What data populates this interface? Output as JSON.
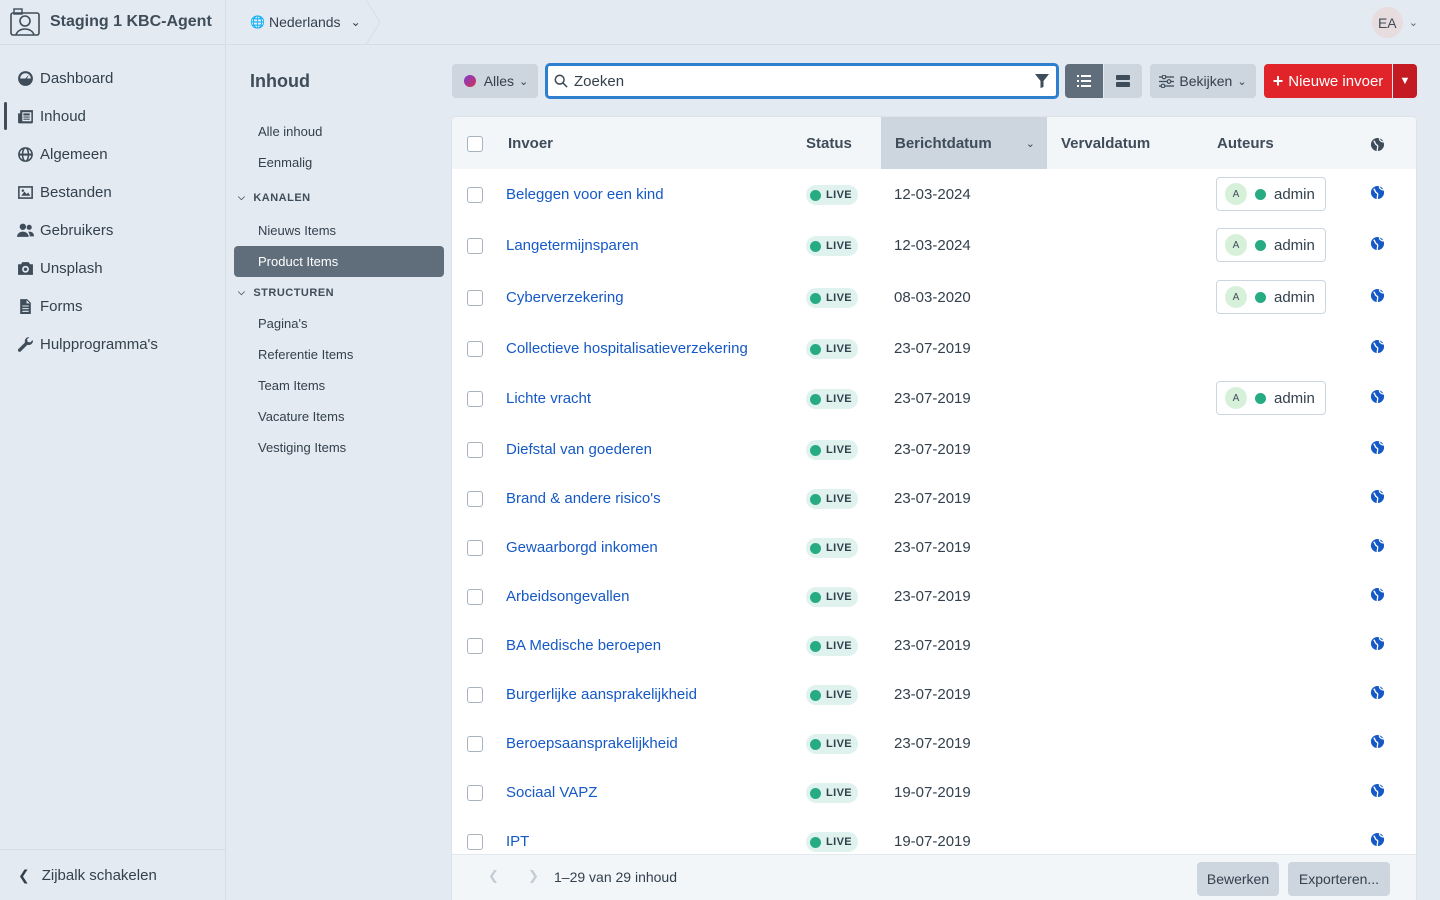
{
  "site": {
    "name": "Staging 1 KBC-Agent"
  },
  "global_nav": [
    {
      "label": "Dashboard",
      "icon": "gauge-icon"
    },
    {
      "label": "Inhoud",
      "icon": "newspaper-icon",
      "active": true
    },
    {
      "label": "Algemeen",
      "icon": "globe-icon"
    },
    {
      "label": "Bestanden",
      "icon": "image-icon"
    },
    {
      "label": "Gebruikers",
      "icon": "users-icon"
    },
    {
      "label": "Unsplash",
      "icon": "camera-icon"
    },
    {
      "label": "Forms",
      "icon": "file-icon"
    },
    {
      "label": "Hulpprogramma's",
      "icon": "wrench-icon"
    }
  ],
  "sidebar_toggle": {
    "label": "Zijbalk schakelen"
  },
  "header": {
    "language": "Nederlands",
    "user_initials": "EA"
  },
  "sources": {
    "title": "Inhoud",
    "items": [
      {
        "type": "item",
        "label": "Alle inhoud"
      },
      {
        "type": "item",
        "label": "Eenmalig"
      },
      {
        "type": "heading",
        "label": "KANALEN"
      },
      {
        "type": "item",
        "label": "Nieuws Items"
      },
      {
        "type": "item",
        "label": "Product Items",
        "active": true
      },
      {
        "type": "heading",
        "label": "STRUCTUREN"
      },
      {
        "type": "item",
        "label": "Pagina's"
      },
      {
        "type": "item",
        "label": "Referentie Items"
      },
      {
        "type": "item",
        "label": "Team Items"
      },
      {
        "type": "item",
        "label": "Vacature Items"
      },
      {
        "type": "item",
        "label": "Vestiging Items"
      }
    ]
  },
  "toolbar": {
    "site_label": "Alles",
    "search_placeholder": "Zoeken",
    "view_label": "Bekijken",
    "new_entry_label": "Nieuwe invoer"
  },
  "table": {
    "columns": {
      "entry": "Invoer",
      "status": "Status",
      "post_date": "Berichtdatum",
      "expiry_date": "Vervaldatum",
      "authors": "Auteurs"
    },
    "rows": [
      {
        "title": "Beleggen voor een kind",
        "status": "LIVE",
        "post_date": "12-03-2024",
        "author_initial": "A",
        "author": "admin"
      },
      {
        "title": "Langetermijnsparen",
        "status": "LIVE",
        "post_date": "12-03-2024",
        "author_initial": "A",
        "author": "admin"
      },
      {
        "title": "Cyberverzekering",
        "status": "LIVE",
        "post_date": "08-03-2020",
        "author_initial": "A",
        "author": "admin"
      },
      {
        "title": "Collectieve hospitalisatieverzekering",
        "status": "LIVE",
        "post_date": "23-07-2019",
        "author": ""
      },
      {
        "title": "Lichte vracht",
        "status": "LIVE",
        "post_date": "23-07-2019",
        "author_initial": "A",
        "author": "admin"
      },
      {
        "title": "Diefstal van goederen",
        "status": "LIVE",
        "post_date": "23-07-2019",
        "author": ""
      },
      {
        "title": "Brand & andere risico's",
        "status": "LIVE",
        "post_date": "23-07-2019",
        "author": ""
      },
      {
        "title": "Gewaarborgd inkomen",
        "status": "LIVE",
        "post_date": "23-07-2019",
        "author": ""
      },
      {
        "title": "Arbeidsongevallen",
        "status": "LIVE",
        "post_date": "23-07-2019",
        "author": ""
      },
      {
        "title": "BA Medische beroepen",
        "status": "LIVE",
        "post_date": "23-07-2019",
        "author": ""
      },
      {
        "title": "Burgerlijke aansprakelijkheid",
        "status": "LIVE",
        "post_date": "23-07-2019",
        "author": ""
      },
      {
        "title": "Beroepsaansprakelijkheid",
        "status": "LIVE",
        "post_date": "23-07-2019",
        "author": ""
      },
      {
        "title": "Sociaal VAPZ",
        "status": "LIVE",
        "post_date": "19-07-2019",
        "author": ""
      },
      {
        "title": "IPT",
        "status": "LIVE",
        "post_date": "19-07-2019",
        "author": ""
      }
    ]
  },
  "footer": {
    "pagination": "1–29 van 29 inhoud",
    "edit_label": "Bewerken",
    "export_label": "Exporteren..."
  },
  "colors": {
    "accent": "#2f7fcf",
    "primary": "#e1232a",
    "live": "#27ab83",
    "link": "#1559c6"
  }
}
